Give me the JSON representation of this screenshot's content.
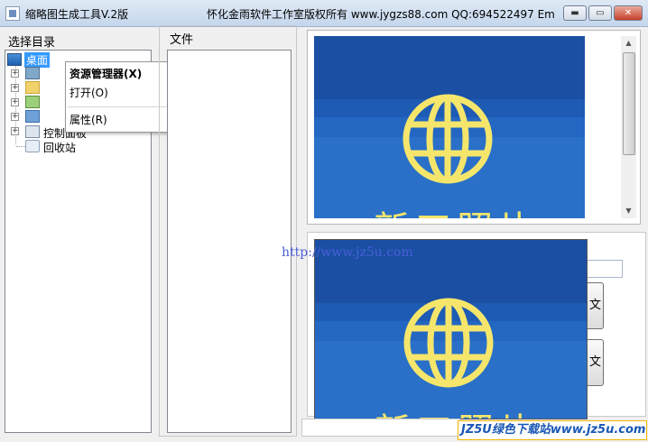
{
  "window": {
    "title": "缩略图生成工具V.2版",
    "title_right": "怀化金雨软件工作室版权所有 www.jygzs88.com QQ:694522497   Em",
    "min_glyph": "▬",
    "max_glyph": "▭",
    "close_glyph": "✕"
  },
  "left_pane": {
    "label": "选择目录",
    "tree": [
      {
        "label": "桌面",
        "selected": true
      },
      {
        "label": "控制面板"
      },
      {
        "label": "回收站"
      }
    ]
  },
  "context_menu": {
    "items": [
      "资源管理器(X)",
      "打开(O)",
      "属性(R)"
    ]
  },
  "middle_pane": {
    "label": "文件"
  },
  "preview": {
    "text": "新工照片",
    "colors": {
      "bg": "#1a4fa3",
      "accent": "#f5e66b"
    }
  },
  "right_buttons": {
    "btn1": "文",
    "btn2": "文"
  },
  "watermarks": {
    "url": "http://www.jz5u.com",
    "site": "JZ5U绿色下载站www.jz5u.com"
  }
}
